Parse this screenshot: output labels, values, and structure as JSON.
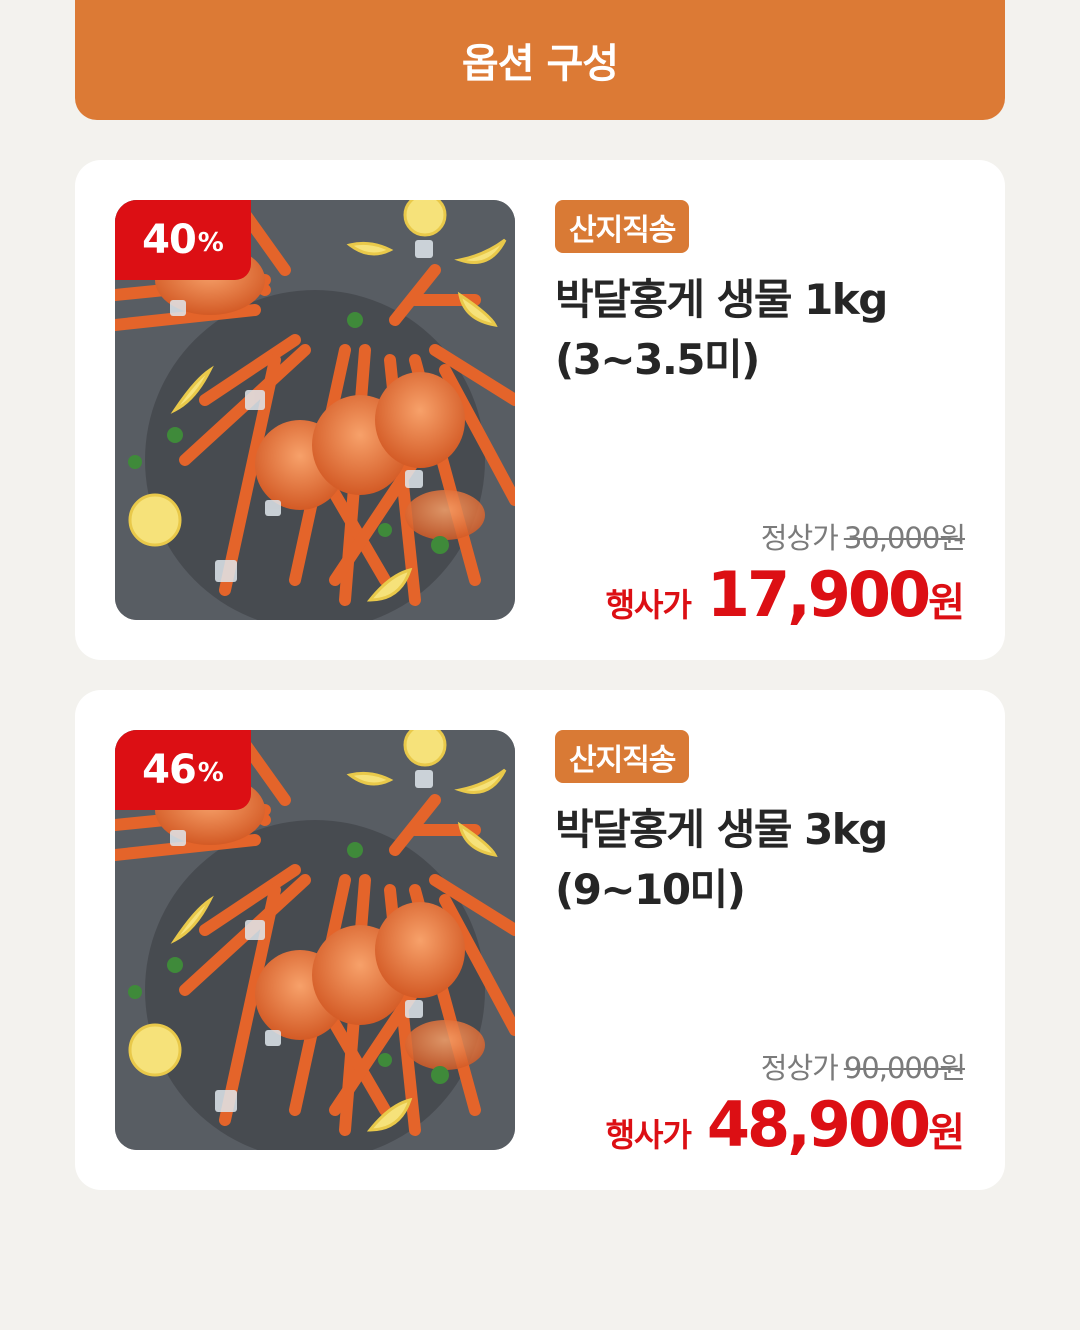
{
  "header": {
    "title": "옵션 구성"
  },
  "products": [
    {
      "discount_num": "40",
      "discount_unit": "%",
      "badge": "산지직송",
      "name_line1": "박달홍게 생물 1kg",
      "name_line2": "(3~3.5미)",
      "regular_label": "정상가",
      "regular_price": "30,000원",
      "sale_label": "행사가",
      "sale_price": "17,900",
      "sale_unit": "원"
    },
    {
      "discount_num": "46",
      "discount_unit": "%",
      "badge": "산지직송",
      "name_line1": "박달홍게 생물 3kg",
      "name_line2": "(9~10미)",
      "regular_label": "정상가",
      "regular_price": "90,000원",
      "sale_label": "행사가",
      "sale_price": "48,900",
      "sale_unit": "원"
    }
  ],
  "colors": {
    "accent": "#dc7a35",
    "sale": "#dc0f14"
  }
}
